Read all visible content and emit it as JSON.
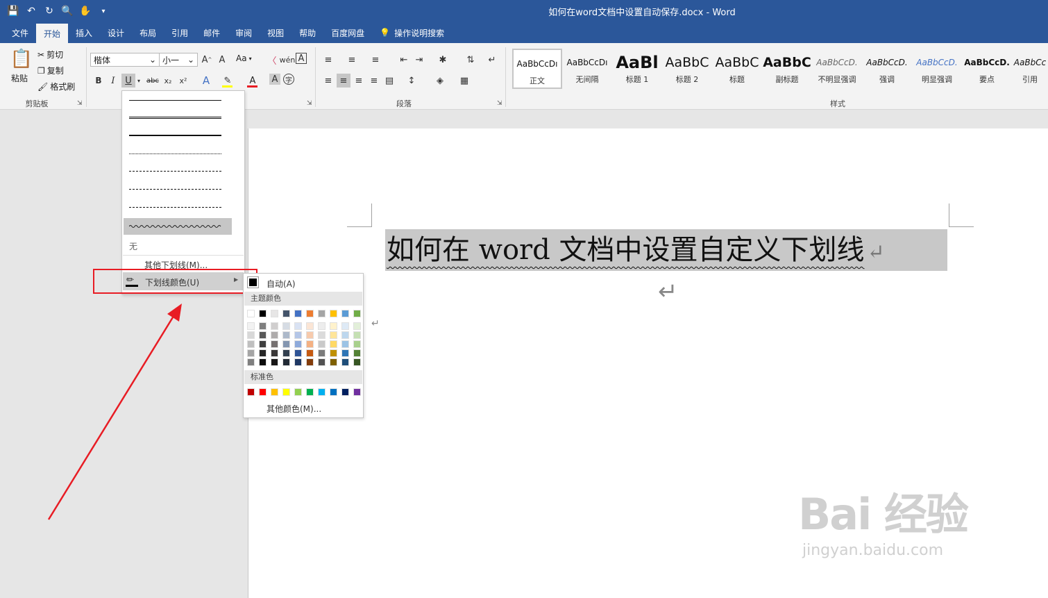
{
  "window": {
    "title": "如何在word文档中设置自动保存.docx - Word",
    "accent": "#2b579a"
  },
  "qat_icons": [
    "save-icon",
    "undo-icon",
    "redo-icon",
    "print-preview-icon",
    "touch-mode-icon",
    "customize-icon"
  ],
  "tabs": [
    {
      "label": "文件"
    },
    {
      "label": "开始"
    },
    {
      "label": "插入"
    },
    {
      "label": "设计"
    },
    {
      "label": "布局"
    },
    {
      "label": "引用"
    },
    {
      "label": "邮件"
    },
    {
      "label": "审阅"
    },
    {
      "label": "视图"
    },
    {
      "label": "帮助"
    },
    {
      "label": "百度网盘"
    },
    {
      "label": "操作说明搜索"
    }
  ],
  "clipboard": {
    "paste": "粘贴",
    "cut": "剪切",
    "copy": "复制",
    "format_painter": "格式刷",
    "group_label": "剪贴板"
  },
  "font": {
    "name": "楷体",
    "size": "小一",
    "bold": "B",
    "italic": "I",
    "underline": "U",
    "strike": "abc",
    "subscript": "x₂",
    "superscript": "x²",
    "case": "Aa"
  },
  "paragraph": {
    "group_label": "段落"
  },
  "styles": {
    "group_label": "样式",
    "items": [
      {
        "preview": "AaBbCcDı",
        "name": "正文"
      },
      {
        "preview": "AaBbCcDı",
        "name": "无间隔"
      },
      {
        "preview": "AaBl",
        "name": "标题 1"
      },
      {
        "preview": "AaBbC",
        "name": "标题 2"
      },
      {
        "preview": "AaBbC",
        "name": "标题"
      },
      {
        "preview": "AaBbC",
        "name": "副标题"
      },
      {
        "preview": "AaBbCcD.",
        "name": "不明显强调"
      },
      {
        "preview": "AaBbCcD.",
        "name": "强调"
      },
      {
        "preview": "AaBbCcD.",
        "name": "明显强调"
      },
      {
        "preview": "AaBbCcD.",
        "name": "要点"
      },
      {
        "preview": "AaBbCc",
        "name": "引用"
      }
    ]
  },
  "underline_menu": {
    "none": "无",
    "more": "其他下划线(M)...",
    "color": "下划线颜色(U)"
  },
  "color_menu": {
    "auto": "自动(A)",
    "theme_label": "主题颜色",
    "standard_label": "标准色",
    "more": "其他颜色(M)...",
    "theme_top": [
      "#ffffff",
      "#000000",
      "#e7e6e6",
      "#44546a",
      "#4472c4",
      "#ed7d31",
      "#a5a5a5",
      "#ffc000",
      "#5b9bd5",
      "#70ad47"
    ],
    "theme_shades": [
      [
        "#f2f2f2",
        "#7f7f7f",
        "#d0cece",
        "#d6dce4",
        "#d9e2f3",
        "#fbe5d5",
        "#ededed",
        "#fff2cc",
        "#deeaf6",
        "#e2efd9"
      ],
      [
        "#d8d8d8",
        "#595959",
        "#aeabab",
        "#adb9ca",
        "#b4c6e7",
        "#f7caac",
        "#dbdbdb",
        "#ffe599",
        "#bdd7ee",
        "#c5e0b3"
      ],
      [
        "#bfbfbf",
        "#3f3f3f",
        "#757070",
        "#8496b0",
        "#8eaadb",
        "#f4b183",
        "#c9c9c9",
        "#ffd965",
        "#9cc3e5",
        "#a8d08d"
      ],
      [
        "#a5a5a5",
        "#262626",
        "#3a3838",
        "#323f4f",
        "#2f5496",
        "#c55a11",
        "#7b7b7b",
        "#bf9000",
        "#2e75b5",
        "#538135"
      ],
      [
        "#7f7f7f",
        "#0c0c0c",
        "#171616",
        "#222a35",
        "#1f3864",
        "#833c0b",
        "#525252",
        "#7f6000",
        "#1e4e79",
        "#375623"
      ]
    ],
    "standard": [
      "#c00000",
      "#ff0000",
      "#ffc000",
      "#ffff00",
      "#92d050",
      "#00b050",
      "#00b0f0",
      "#0070c0",
      "#002060",
      "#7030a0"
    ]
  },
  "document": {
    "heading": "如何在 word 文档中设置自定义下划线"
  },
  "watermark": {
    "brand": "Bai  经验",
    "url": "jingyan.baidu.com"
  },
  "highlight_color": "#e81c24"
}
